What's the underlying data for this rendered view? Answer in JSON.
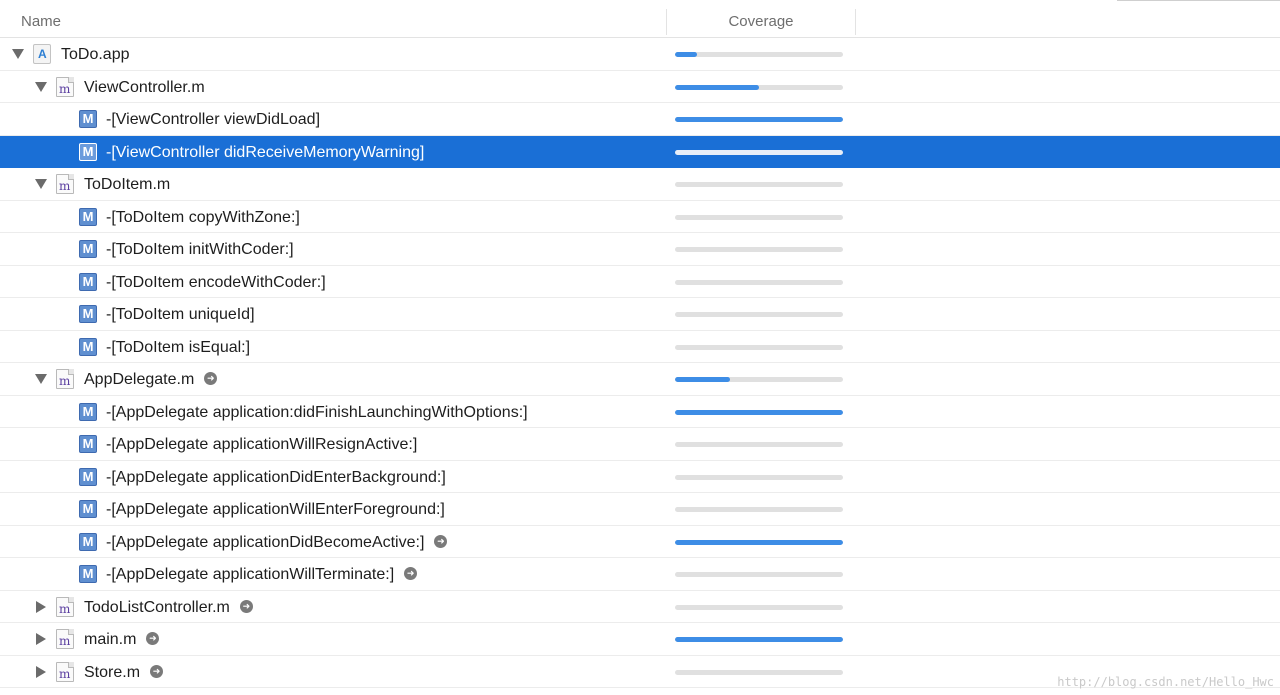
{
  "header": {
    "name_label": "Name",
    "coverage_label": "Coverage"
  },
  "colors": {
    "accent": "#3d8de6",
    "selection": "#1a6fd6",
    "track": "#e0e0e0"
  },
  "rows": [
    {
      "label": "ToDo.app",
      "kind": "app",
      "depth": 0,
      "disclosure": "open",
      "coverage": 0.13,
      "nav": false,
      "icon": "app-icon"
    },
    {
      "label": "ViewController.m",
      "kind": "file",
      "depth": 1,
      "disclosure": "open",
      "coverage": 0.5,
      "nav": false,
      "icon": "objc-file-icon"
    },
    {
      "label": "-[ViewController viewDidLoad]",
      "kind": "method",
      "depth": 2,
      "coverage": 1.0,
      "nav": false,
      "icon": "method-icon"
    },
    {
      "label": "-[ViewController didReceiveMemoryWarning]",
      "kind": "method",
      "depth": 2,
      "coverage": 0.0,
      "nav": false,
      "selected": true,
      "icon": "method-icon"
    },
    {
      "label": "ToDoItem.m",
      "kind": "file",
      "depth": 1,
      "disclosure": "open",
      "coverage": 0.0,
      "nav": false,
      "icon": "objc-file-icon"
    },
    {
      "label": "-[ToDoItem copyWithZone:]",
      "kind": "method",
      "depth": 2,
      "coverage": 0.0,
      "nav": false,
      "icon": "method-icon"
    },
    {
      "label": "-[ToDoItem initWithCoder:]",
      "kind": "method",
      "depth": 2,
      "coverage": 0.0,
      "nav": false,
      "icon": "method-icon"
    },
    {
      "label": "-[ToDoItem encodeWithCoder:]",
      "kind": "method",
      "depth": 2,
      "coverage": 0.0,
      "nav": false,
      "icon": "method-icon"
    },
    {
      "label": "-[ToDoItem uniqueId]",
      "kind": "method",
      "depth": 2,
      "coverage": 0.0,
      "nav": false,
      "icon": "method-icon"
    },
    {
      "label": "-[ToDoItem isEqual:]",
      "kind": "method",
      "depth": 2,
      "coverage": 0.0,
      "nav": false,
      "icon": "method-icon"
    },
    {
      "label": "AppDelegate.m",
      "kind": "file",
      "depth": 1,
      "disclosure": "open",
      "coverage": 0.33,
      "nav": true,
      "icon": "objc-file-icon"
    },
    {
      "label": "-[AppDelegate application:didFinishLaunchingWithOptions:]",
      "kind": "method",
      "depth": 2,
      "coverage": 1.0,
      "nav": false,
      "icon": "method-icon"
    },
    {
      "label": "-[AppDelegate applicationWillResignActive:]",
      "kind": "method",
      "depth": 2,
      "coverage": 0.0,
      "nav": false,
      "icon": "method-icon"
    },
    {
      "label": "-[AppDelegate applicationDidEnterBackground:]",
      "kind": "method",
      "depth": 2,
      "coverage": 0.0,
      "nav": false,
      "icon": "method-icon"
    },
    {
      "label": "-[AppDelegate applicationWillEnterForeground:]",
      "kind": "method",
      "depth": 2,
      "coverage": 0.0,
      "nav": false,
      "icon": "method-icon"
    },
    {
      "label": "-[AppDelegate applicationDidBecomeActive:]",
      "kind": "method",
      "depth": 2,
      "coverage": 1.0,
      "nav": true,
      "icon": "method-icon"
    },
    {
      "label": "-[AppDelegate applicationWillTerminate:]",
      "kind": "method",
      "depth": 2,
      "coverage": 0.0,
      "nav": true,
      "icon": "method-icon"
    },
    {
      "label": "TodoListController.m",
      "kind": "file",
      "depth": 1,
      "disclosure": "closed",
      "coverage": 0.0,
      "nav": true,
      "icon": "objc-file-icon"
    },
    {
      "label": "main.m",
      "kind": "file",
      "depth": 1,
      "disclosure": "closed",
      "coverage": 1.0,
      "nav": true,
      "icon": "objc-file-icon"
    },
    {
      "label": "Store.m",
      "kind": "file",
      "depth": 1,
      "disclosure": "closed",
      "coverage": 0.0,
      "nav": true,
      "icon": "objc-file-icon"
    }
  ],
  "icons": {
    "file_glyph": "m",
    "method_glyph": "M",
    "app_glyph": "A",
    "nav_glyph": "➜"
  },
  "watermark": "http://blog.csdn.net/Hello_Hwc"
}
